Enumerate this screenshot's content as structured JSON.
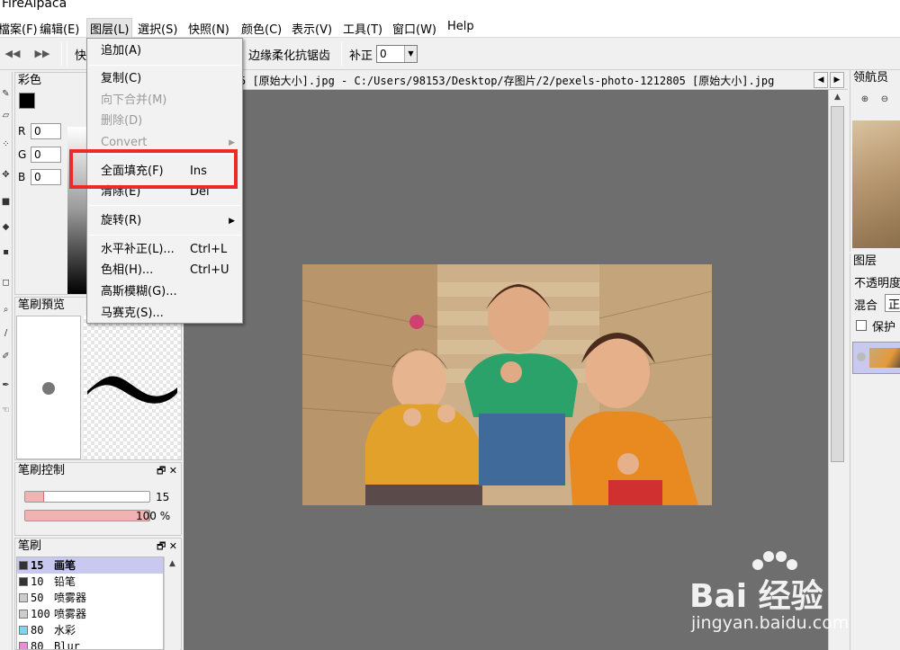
{
  "app": {
    "title": "FireAlpaca"
  },
  "menubar": {
    "items": [
      "檔案(F)",
      "编辑(E)",
      "图层(L)",
      "選択(S)",
      "快照(N)",
      "颜色(C)",
      "表示(V)",
      "工具(T)",
      "窗口(W)",
      "Help"
    ],
    "active_index": 2
  },
  "toolbar": {
    "prefix_label": "快",
    "antialias_label": "边缘柔化抗锯齿",
    "correction_label": "补正",
    "correction_value": "0"
  },
  "layer_menu": {
    "items": [
      {
        "label": "追加(A)",
        "shortcut": "",
        "enabled": true
      },
      {
        "label": "复制(C)",
        "shortcut": "",
        "enabled": true
      },
      {
        "label": "向下合并(M)",
        "shortcut": "",
        "enabled": false
      },
      {
        "label": "删除(D)",
        "shortcut": "",
        "enabled": false
      },
      {
        "label": "Convert",
        "shortcut": "",
        "enabled": false
      },
      {
        "label": "全面填充(F)",
        "shortcut": "Ins",
        "enabled": true
      },
      {
        "label": "清除(E)",
        "shortcut": "Del",
        "enabled": true
      },
      {
        "label": "旋转(R)",
        "shortcut": "",
        "enabled": true
      },
      {
        "label": "水平补正(L)...",
        "shortcut": "Ctrl+L",
        "enabled": true
      },
      {
        "label": "色相(H)...",
        "shortcut": "Ctrl+U",
        "enabled": true
      },
      {
        "label": "高斯模糊(G)...",
        "shortcut": "",
        "enabled": true
      },
      {
        "label": "马赛克(S)...",
        "shortcut": "",
        "enabled": true
      }
    ]
  },
  "color_panel": {
    "title": "彩色",
    "r_label": "R",
    "g_label": "G",
    "b_label": "B",
    "r": "0",
    "g": "0",
    "b": "0",
    "foreground": "#000000",
    "background": "#ffffff"
  },
  "brush_preview": {
    "title": "笔刷預览"
  },
  "brush_control": {
    "title": "笔刷控制",
    "size_value": "15",
    "opacity_value": "100 %",
    "size_fraction": 0.15,
    "opacity_fraction": 1.0
  },
  "brushes": {
    "title": "笔刷",
    "items": [
      {
        "size": "15",
        "name": "画笔",
        "color": "#333333",
        "selected": true
      },
      {
        "size": "10",
        "name": "铅笔",
        "color": "#333333",
        "selected": false
      },
      {
        "size": "50",
        "name": "喷雾器",
        "color": "#cccccc",
        "selected": false
      },
      {
        "size": "100",
        "name": "喷雾器",
        "color": "#cccccc",
        "selected": false
      },
      {
        "size": "80",
        "name": "水彩",
        "color": "#7fd6ec",
        "selected": false
      },
      {
        "size": "80",
        "name": "Blur",
        "color": "#f08ad6",
        "selected": false
      }
    ]
  },
  "canvas": {
    "tab_path": "5 [原始大小].jpg - C:/Users/98153/Desktop/存图片/2/pexels-photo-1212805 [原始大小].jpg",
    "background": "#6e6e6e"
  },
  "navigator": {
    "title": "领航员"
  },
  "layers_panel": {
    "title": "图层",
    "opacity_label": "不透明度",
    "blend_label": "混合",
    "blend_value": "正",
    "protect_label": "保护"
  },
  "watermark": {
    "brand": "Bai 经验",
    "url": "jingyan.baidu.com"
  },
  "colors": {
    "highlight": "#ec2a2a",
    "menu_bg": "#f2f2f2",
    "selected_row": "#c8c8f0",
    "slider_fill": "#f0b3b3"
  }
}
